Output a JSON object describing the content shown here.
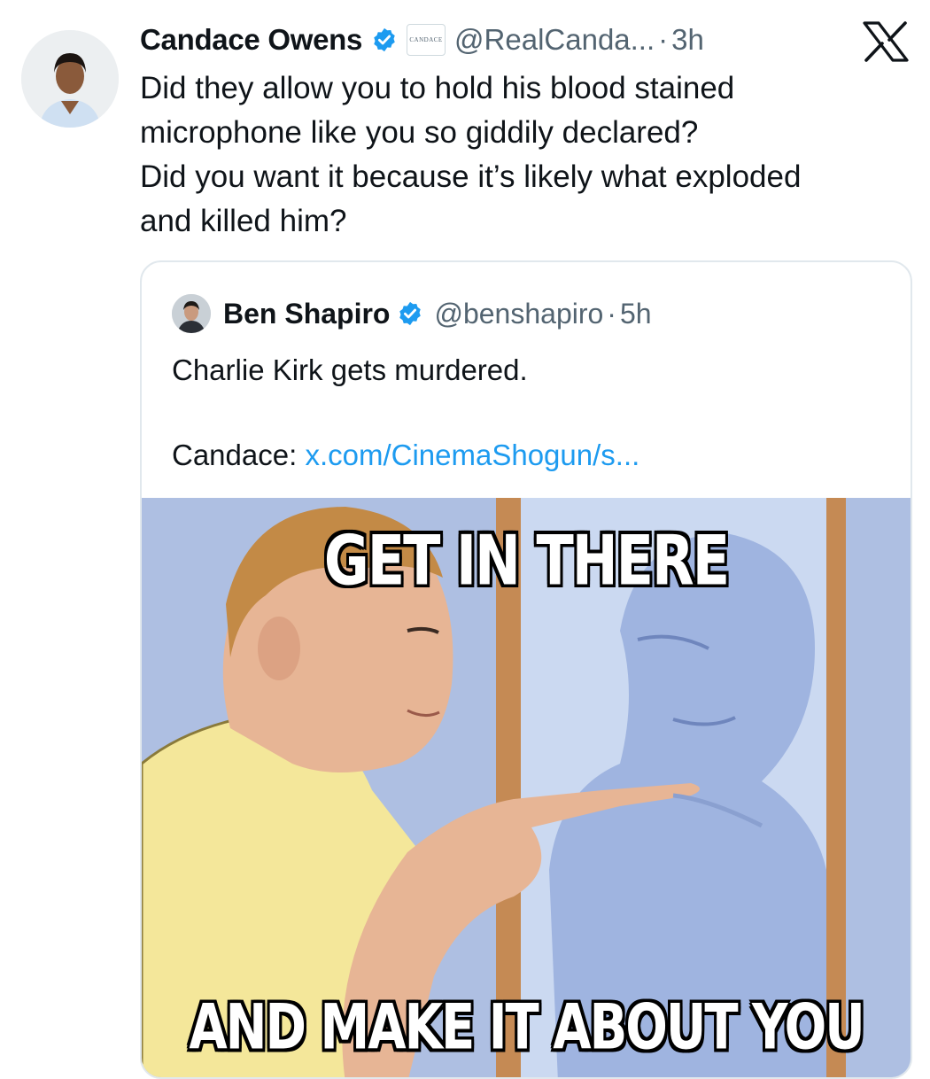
{
  "tweet": {
    "author_name": "Candace Owens",
    "affiliate_badge": "CANDACE",
    "handle": "@RealCanda...",
    "separator": "·",
    "time": "3h",
    "lines": [
      "Did they allow you to hold his blood stained",
      "microphone like you so giddily declared?",
      "Did you want it because it’s likely what exploded",
      "and killed him?"
    ]
  },
  "quote": {
    "author_name": "Ben Shapiro",
    "handle": "@benshapiro",
    "separator": "·",
    "time": "5h",
    "line1": "Charlie Kirk gets murdered.",
    "line2_prefix": "Candace: ",
    "link_text": "x.com/CinemaShogun/s...",
    "meme": {
      "top_caption": "GET IN THERE",
      "bottom_caption": "AND MAKE IT ABOUT YOU"
    }
  },
  "icons": {
    "verified": "verified-check-icon",
    "platform": "x-logo-icon"
  },
  "colors": {
    "verified_blue": "#1d9bf0",
    "link_blue": "#1d9bf0",
    "secondary_text": "#536471"
  }
}
